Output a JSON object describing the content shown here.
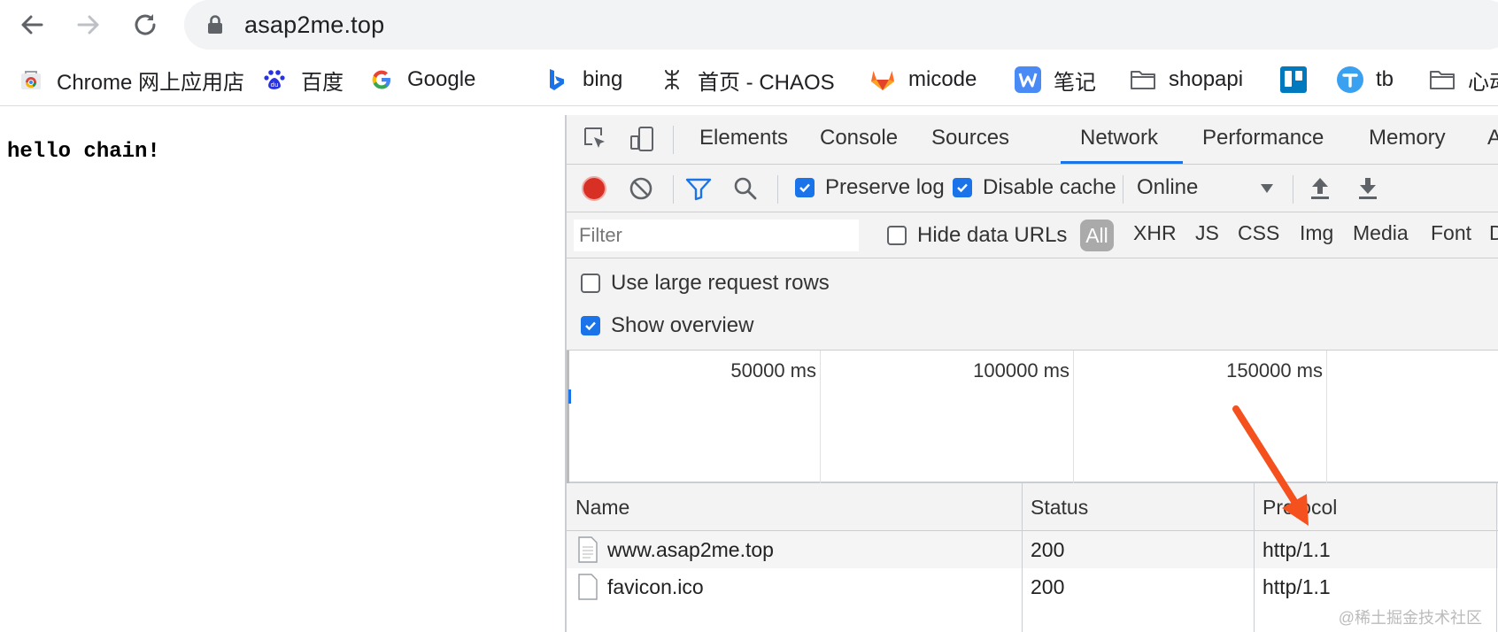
{
  "address_bar": {
    "url": "asap2me.top"
  },
  "bookmarks": [
    {
      "label": "Chrome 网上应用店",
      "icon": "chrome-web-store-icon"
    },
    {
      "label": "百度",
      "icon": "baidu-icon"
    },
    {
      "label": "Google",
      "icon": "google-icon"
    },
    {
      "label": "bing",
      "icon": "bing-icon"
    },
    {
      "label": "首页 - CHAOS",
      "icon": "chaos-icon"
    },
    {
      "label": "micode",
      "icon": "gitlab-icon"
    },
    {
      "label": "笔记",
      "icon": "wiz-note-icon"
    },
    {
      "label": "shopapi",
      "icon": "folder-icon"
    },
    {
      "label": "",
      "icon": "trello-icon"
    },
    {
      "label": "tb",
      "icon": "tb-icon"
    },
    {
      "label": "心动",
      "icon": "folder-icon"
    }
  ],
  "page": {
    "text": "hello chain!"
  },
  "devtools": {
    "tabs": [
      "Elements",
      "Console",
      "Sources",
      "Network",
      "Performance",
      "Memory",
      "Application"
    ],
    "active_tab": "Network",
    "toolbar": {
      "preserve_log": "Preserve log",
      "disable_cache": "Disable cache",
      "throttling": "Online"
    },
    "filter": {
      "placeholder": "Filter",
      "hide_data_urls": "Hide data URLs",
      "all": "All",
      "types": [
        "XHR",
        "JS",
        "CSS",
        "Img",
        "Media",
        "Font",
        "Doc"
      ]
    },
    "settings": {
      "large_rows": "Use large request rows",
      "show_overview": "Show overview"
    },
    "overview_labels": [
      "50000 ms",
      "100000 ms",
      "150000 ms"
    ],
    "table": {
      "columns": [
        "Name",
        "Status",
        "Protocol"
      ],
      "rows": [
        {
          "name": "www.asap2me.top",
          "status": "200",
          "protocol": "http/1.1"
        },
        {
          "name": "favicon.ico",
          "status": "200",
          "protocol": "http/1.1"
        }
      ]
    }
  },
  "watermark": "@稀土掘金技术社区",
  "colors": {
    "accent": "#1a73e8",
    "record": "#d93025",
    "arrow": "#f4511e"
  }
}
